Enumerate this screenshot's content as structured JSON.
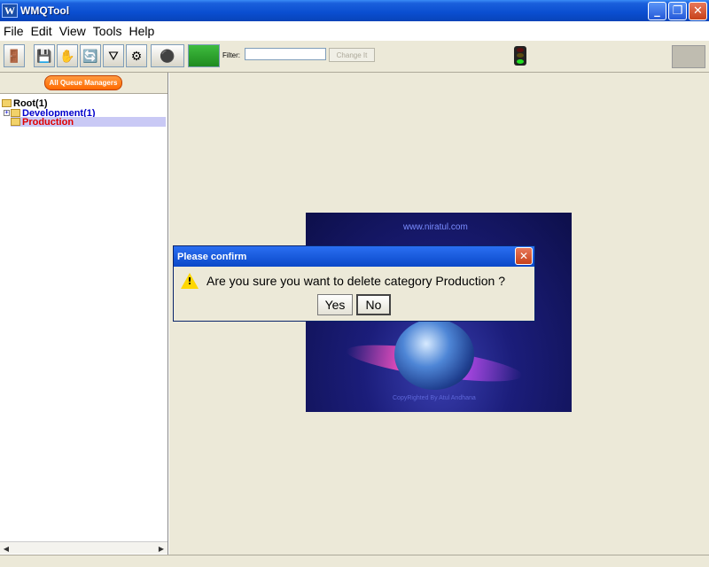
{
  "window": {
    "title": "WMQTool",
    "icon_letter": "W"
  },
  "menu": {
    "items": [
      "File",
      "Edit",
      "View",
      "Tools",
      "Help"
    ]
  },
  "toolbar": {
    "filter_label": "Filter:",
    "filter_value": "",
    "change_button": "Change It"
  },
  "left_panel": {
    "all_qm_button": "All Queue Managers",
    "tree": {
      "root": "Root(1)",
      "development": "Development(1)",
      "production": "Production"
    }
  },
  "splash": {
    "url": "www.niratul.com",
    "copyright": "CopyRighted By Atul Andhana"
  },
  "dialog": {
    "title": "Please confirm",
    "message": "Are you sure you want to delete category Production ?",
    "yes_label": "Yes",
    "no_label": "No"
  },
  "colors": {
    "title_blue": "#0a4ed0",
    "dev_blue": "#0000cc",
    "prod_red": "#e00000",
    "selection": "#c9c9f5"
  }
}
